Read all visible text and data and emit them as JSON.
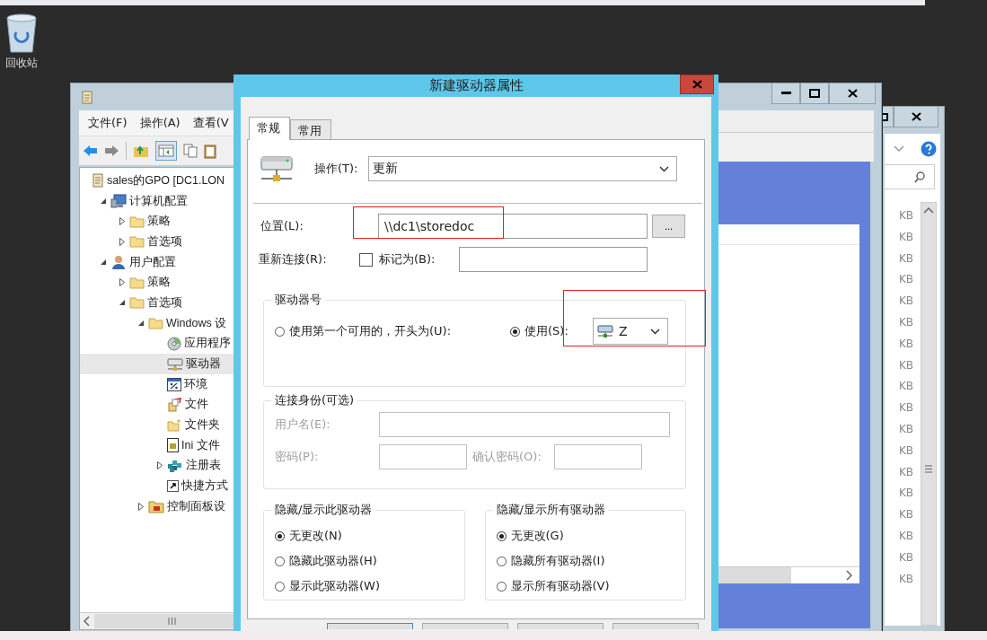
{
  "desktop": {
    "icons": [
      {
        "label": "回收站"
      }
    ]
  },
  "explorer_window": {
    "sizes": [
      "KB",
      "KB",
      "KB",
      "KB",
      "KB",
      "KB",
      "KB",
      "KB",
      "KB",
      "KB",
      "KB",
      "KB",
      "KB",
      "KB",
      "KB",
      "KB",
      "KB",
      "KB"
    ]
  },
  "gpo_window": {
    "menu": [
      "文件(F)",
      "操作(A)",
      "查看(V"
    ],
    "tree": [
      {
        "label": "sales的GPO [DC1.LON",
        "kind": "scroll",
        "selected": false,
        "children": [
          {
            "label": "计算机配置",
            "kind": "computer",
            "expanded": true,
            "selected": false,
            "children": [
              {
                "label": "策略",
                "kind": "folder",
                "expanded": false,
                "selected": false
              },
              {
                "label": "首选项",
                "kind": "folder",
                "expanded": false,
                "selected": false
              }
            ]
          },
          {
            "label": "用户配置",
            "kind": "user",
            "expanded": true,
            "selected": false,
            "children": [
              {
                "label": "策略",
                "kind": "folder",
                "expanded": false,
                "selected": false
              },
              {
                "label": "首选项",
                "kind": "folder",
                "expanded": true,
                "selected": false,
                "children": [
                  {
                    "label": "Windows 设",
                    "kind": "folder",
                    "expanded": true,
                    "selected": false,
                    "children": [
                      {
                        "label": "应用程序",
                        "kind": "disc",
                        "selected": false
                      },
                      {
                        "label": "驱动器",
                        "kind": "drive",
                        "selected": true
                      },
                      {
                        "label": "环境",
                        "kind": "env",
                        "selected": false
                      },
                      {
                        "label": "文件",
                        "kind": "file",
                        "selected": false
                      },
                      {
                        "label": "文件夹",
                        "kind": "newfolder",
                        "selected": false
                      },
                      {
                        "label": "Ini 文件",
                        "kind": "ini",
                        "selected": false
                      },
                      {
                        "label": "注册表",
                        "kind": "registry",
                        "expanded": false,
                        "selected": false
                      },
                      {
                        "label": "快捷方式",
                        "kind": "shortcut",
                        "selected": false
                      }
                    ]
                  },
                  {
                    "label": "控制面板设",
                    "kind": "panel",
                    "expanded": false,
                    "selected": false
                  }
                ]
              }
            ]
          }
        ]
      }
    ]
  },
  "dialog": {
    "title": "新建驱动器属性",
    "tabs": [
      {
        "label": "常规",
        "selected": true
      },
      {
        "label": "常用",
        "selected": false
      }
    ],
    "action": {
      "label": "操作(T):",
      "value": "更新"
    },
    "location": {
      "label": "位置(L):",
      "value": "\\\\dc1\\storedoc",
      "browse": "..."
    },
    "reconnect": {
      "label": "重新连接(R):",
      "checked": false
    },
    "label_as": {
      "label": "标记为(B):"
    },
    "drive_letter": {
      "title": "驱动器号",
      "options": [
        {
          "label": "使用第一个可用的，开头为(U):",
          "selected": false
        },
        {
          "label": "使用(S):",
          "selected": true
        }
      ],
      "letter": "Z"
    },
    "connect_as": {
      "title": "连接身份(可选)",
      "disabled": true,
      "username_label": "用户名(E):",
      "password_label": "密码(P):",
      "confirm_label": "确认密码(O):"
    },
    "hide_this": {
      "title": "隐藏/显示此驱动器",
      "options": [
        {
          "label": "无更改(N)",
          "selected": true
        },
        {
          "label": "隐藏此驱动器(H)",
          "selected": false
        },
        {
          "label": "显示此驱动器(W)",
          "selected": false
        }
      ]
    },
    "hide_all": {
      "title": "隐藏/显示所有驱动器",
      "options": [
        {
          "label": "无更改(G)",
          "selected": true
        },
        {
          "label": "隐藏所有驱动器(I)",
          "selected": false
        },
        {
          "label": "显示所有驱动器(V)",
          "selected": false
        }
      ]
    }
  }
}
